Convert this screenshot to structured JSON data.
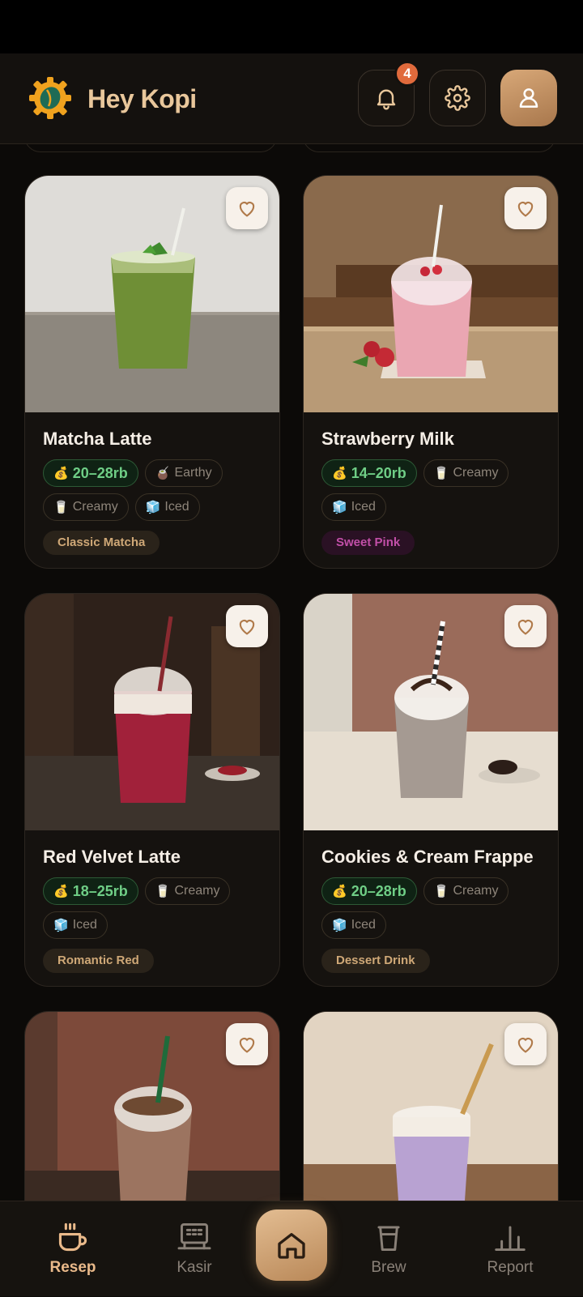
{
  "app": {
    "title": "Hey Kopi",
    "notification_count": "4"
  },
  "cards": [
    {
      "name": "Matcha Latte",
      "price": "20–28rb",
      "tags": [
        {
          "emoji": "🧉",
          "label": "Earthy"
        },
        {
          "emoji": "🥛",
          "label": "Creamy"
        },
        {
          "emoji": "🧊",
          "label": "Iced"
        }
      ],
      "category": "Classic Matcha"
    },
    {
      "name": "Strawberry Milk",
      "price": "14–20rb",
      "tags": [
        {
          "emoji": "🥛",
          "label": "Creamy"
        },
        {
          "emoji": "🧊",
          "label": "Iced"
        }
      ],
      "category": "Sweet Pink"
    },
    {
      "name": "Red Velvet Latte",
      "price": "18–25rb",
      "tags": [
        {
          "emoji": "🥛",
          "label": "Creamy"
        },
        {
          "emoji": "🧊",
          "label": "Iced"
        }
      ],
      "category": "Romantic Red"
    },
    {
      "name": "Cookies & Cream Frappe",
      "price": "20–28rb",
      "tags": [
        {
          "emoji": "🥛",
          "label": "Creamy"
        },
        {
          "emoji": "🧊",
          "label": "Iced"
        }
      ],
      "category": "Dessert Drink"
    },
    {
      "name": "",
      "price": "",
      "tags": [],
      "category": ""
    },
    {
      "name": "",
      "price": "",
      "tags": [],
      "category": ""
    }
  ],
  "price_emoji": "💰",
  "nav": {
    "resep": "Resep",
    "kasir": "Kasir",
    "brew": "Brew",
    "report": "Report"
  },
  "colors": {
    "accent": "#e9b98a",
    "price_green": "#6fce86",
    "badge": "#e06a3c",
    "pink_category": "#c24fa8"
  }
}
